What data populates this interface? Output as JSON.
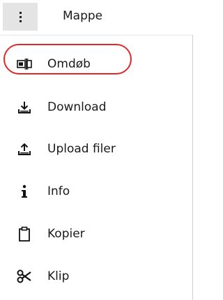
{
  "header": {
    "menu_button": "more-vertical",
    "folder_label": "Mappe"
  },
  "menu": {
    "items": [
      {
        "icon": "rename-icon",
        "label": "Omdøb",
        "highlighted": true
      },
      {
        "icon": "download-icon",
        "label": "Download"
      },
      {
        "icon": "upload-icon",
        "label": "Upload filer"
      },
      {
        "icon": "info-icon",
        "label": "Info"
      },
      {
        "icon": "copy-icon",
        "label": "Kopier"
      },
      {
        "icon": "cut-icon",
        "label": "Klip"
      }
    ]
  },
  "colors": {
    "highlight": "#e02828",
    "menu_button_bg": "#e4e4e4"
  }
}
